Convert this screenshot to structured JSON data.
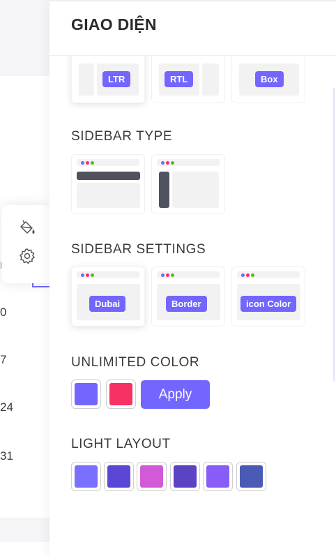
{
  "panel": {
    "title": "GIAO DIỆN"
  },
  "layout_type": {
    "options": [
      {
        "label": "LTR",
        "active": true
      },
      {
        "label": "RTL",
        "active": false
      },
      {
        "label": "Box",
        "active": false
      }
    ]
  },
  "sidebar_type": {
    "title": "SIDEBAR TYPE",
    "options": [
      {
        "name": "horizontal"
      },
      {
        "name": "vertical"
      }
    ]
  },
  "sidebar_settings": {
    "title": "SIDEBAR SETTINGS",
    "options": [
      {
        "label": "Dubai",
        "active": true
      },
      {
        "label": "Border",
        "active": false
      },
      {
        "label": "icon Color",
        "active": false
      }
    ]
  },
  "unlimited_color": {
    "title": "UNLIMITED COLOR",
    "primary": "#7366ff",
    "secondary": "#f73164",
    "apply_label": "Apply"
  },
  "light_layout": {
    "title": "LIGHT LAYOUT",
    "colors": [
      "#7a70ff",
      "#5b47d6",
      "#d35ad6",
      "#5c43c4",
      "#8a5cf7",
      "#4a5ab5"
    ]
  },
  "background_page": {
    "numbers": [
      "0",
      "7",
      "24",
      "31"
    ]
  },
  "icons": {
    "paint": "paint-bucket-icon",
    "settings": "gear-icon"
  }
}
